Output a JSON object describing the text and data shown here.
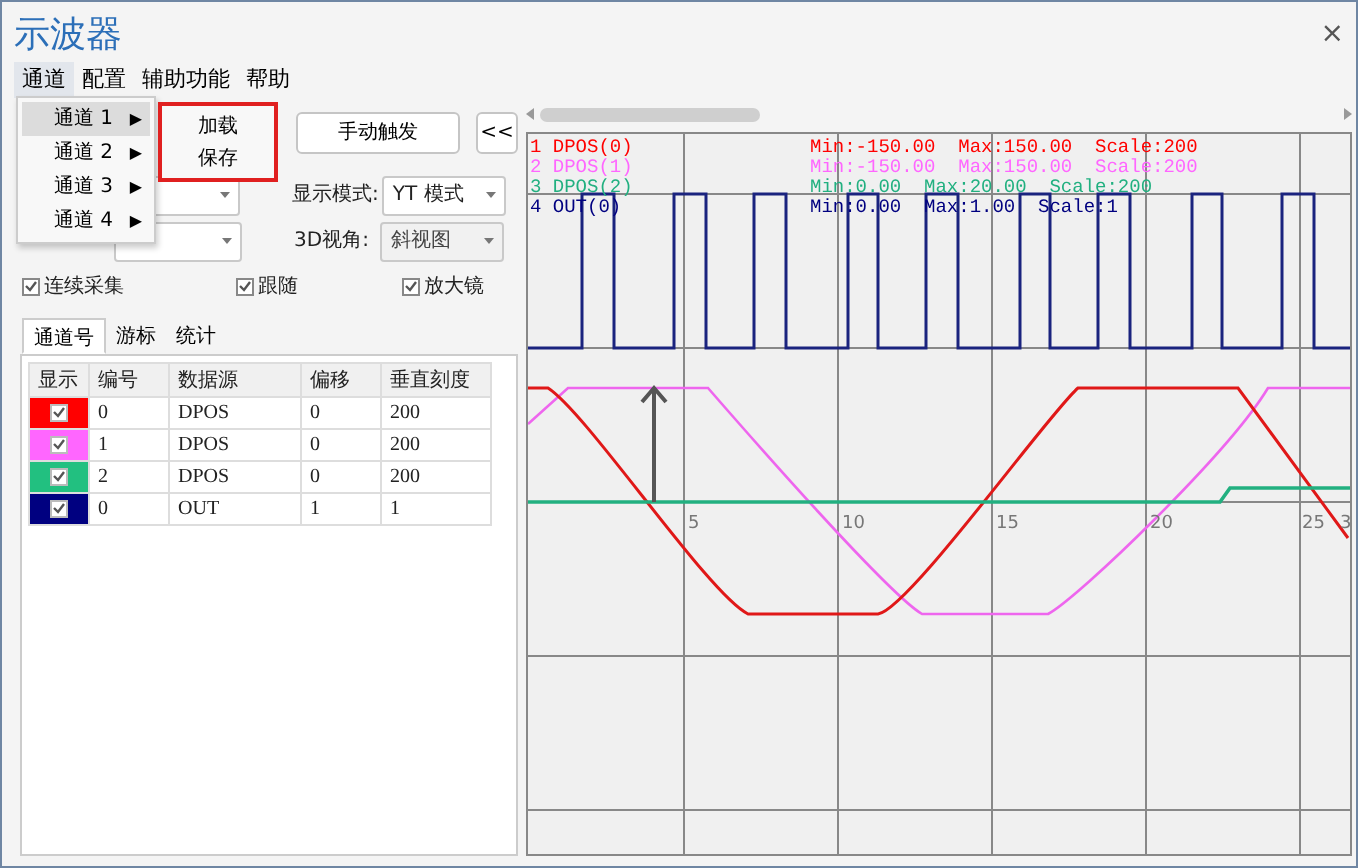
{
  "window": {
    "title": "示波器",
    "close": "×"
  },
  "menu_bar": [
    {
      "label": "通道",
      "selected": true
    },
    {
      "label": "配置",
      "selected": false
    },
    {
      "label": "辅助功能",
      "selected": false
    },
    {
      "label": "帮助",
      "selected": false
    }
  ],
  "channel_menu": [
    {
      "label": "通道 1",
      "arrow": "▶",
      "selected": true
    },
    {
      "label": "通道 2",
      "arrow": "▶",
      "selected": false
    },
    {
      "label": "通道 3",
      "arrow": "▶",
      "selected": false
    },
    {
      "label": "通道 4",
      "arrow": "▶",
      "selected": false
    }
  ],
  "submenu": [
    "加载",
    "保存"
  ],
  "controls": {
    "trigger_button": "手动触发",
    "collapse_button": "<<",
    "display_mode": {
      "label": "显示模式:",
      "value": "YT 模式"
    },
    "view_3d": {
      "label": "3D视角:",
      "value": "斜视图",
      "disabled": true
    }
  },
  "checkboxes": [
    {
      "label": "连续采集",
      "checked": true
    },
    {
      "label": "跟随",
      "checked": true
    },
    {
      "label": "放大镜",
      "checked": true
    }
  ],
  "tabs": [
    {
      "label": "通道号",
      "selected": true
    },
    {
      "label": "游标",
      "selected": false
    },
    {
      "label": "统计",
      "selected": false
    }
  ],
  "table": {
    "columns": [
      "显示",
      "编号",
      "数据源",
      "偏移",
      "垂直刻度"
    ],
    "rows": [
      {
        "color": "#ff0000",
        "shown": true,
        "cells": [
          "",
          "0",
          "DPOS",
          "0",
          "200"
        ]
      },
      {
        "color": "#ff66ff",
        "shown": true,
        "cells": [
          "",
          "1",
          "DPOS",
          "0",
          "200"
        ]
      },
      {
        "color": "#22c080",
        "shown": true,
        "cells": [
          "",
          "2",
          "DPOS",
          "0",
          "200"
        ]
      },
      {
        "color": "#000080",
        "shown": true,
        "cells": [
          "",
          "0",
          "OUT",
          "1",
          "1"
        ]
      }
    ]
  },
  "scope": {
    "legend": [
      {
        "name": "1 DPOS(0)",
        "range": "Min:-150.00  Max:150.00  Scale:200",
        "color": "#ff0000"
      },
      {
        "name": "2 DPOS(1)",
        "range": "Min:-150.00  Max:150.00  Scale:200",
        "color": "#ff66ff"
      },
      {
        "name": "3 DPOS(2)",
        "range": "Min:0.00  Max:20.00  Scale:200",
        "color": "#22b080"
      },
      {
        "name": "4 OUT(0)",
        "range": "Min:0.00  Max:1.00  Scale:1",
        "color": "#000080"
      }
    ],
    "x_tick_labels": [
      "5",
      "10",
      "15",
      "20",
      "25",
      "3"
    ]
  }
}
